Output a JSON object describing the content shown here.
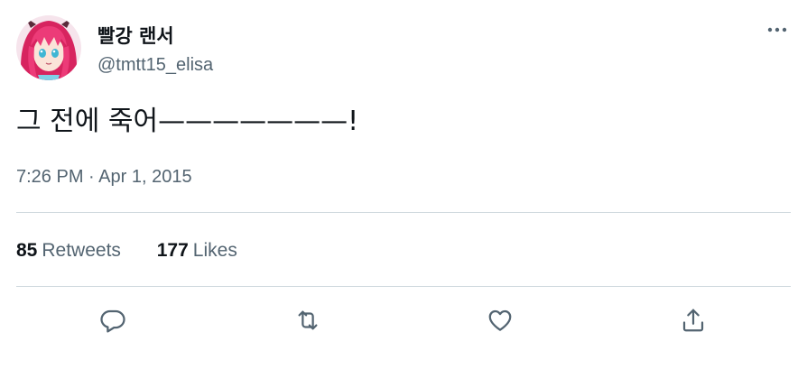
{
  "author": {
    "display_name": "빨강 랜서",
    "handle": "@tmtt15_elisa",
    "avatar_icon": "avatar-anime-pink-hair"
  },
  "tweet": {
    "text": "그 전에 죽어———————!",
    "timestamp": "7:26 PM · Apr 1, 2015"
  },
  "stats": {
    "retweets_count": "85",
    "retweets_label": "Retweets",
    "likes_count": "177",
    "likes_label": "Likes"
  },
  "actions": {
    "reply_icon": "reply-icon",
    "retweet_icon": "retweet-icon",
    "like_icon": "like-icon",
    "share_icon": "share-icon",
    "more_icon": "more-icon"
  },
  "colors": {
    "primary_text": "#0f1419",
    "secondary_text": "#536471",
    "divider": "#cfd9de",
    "avatar_hair": "#e0306a",
    "avatar_eyes": "#3fb6d4"
  }
}
